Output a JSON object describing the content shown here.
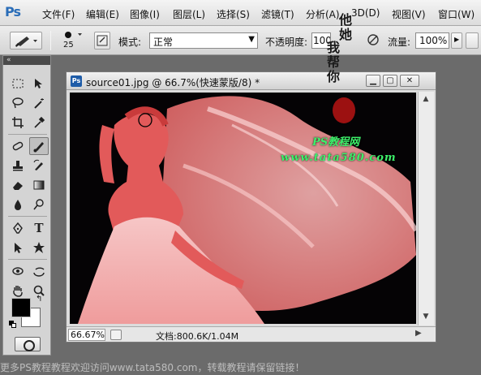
{
  "app": {
    "logo": "Ps"
  },
  "menu": [
    "文件(F)",
    "编辑(E)",
    "图像(I)",
    "图层(L)",
    "选择(S)",
    "滤镜(T)",
    "分析(A)",
    "3D(D)",
    "视图(V)",
    "窗口(W)"
  ],
  "options": {
    "brush_size": "25",
    "mode_label": "模式:",
    "mode_value": "正常",
    "opacity_label": "不透明度:",
    "opacity_value": "100",
    "flow_label": "流量:",
    "flow_value": "100%"
  },
  "document": {
    "title": "source01.jpg @ 66.7%(快速蒙版/8) *",
    "zoom": "66.67%",
    "info": "文档:800.6K/1.04M"
  },
  "colors": {
    "foreground": "#000000",
    "background": "#ffffff",
    "mask_overlay": "#ff5c5c"
  },
  "watermarks": {
    "vertical_right": "他她",
    "vertical_left": "我帮你",
    "site_label": "PS教程网",
    "site_url": "www.tata580.com",
    "bottom": "更多PS教程教程欢迎访问www.tata580.com，转载教程请保留链接！"
  },
  "icons": {
    "brush_tool": "brush-icon",
    "fg_bg_swap": "swap-colors-icon",
    "quick_mask": "quick-mask-icon"
  }
}
